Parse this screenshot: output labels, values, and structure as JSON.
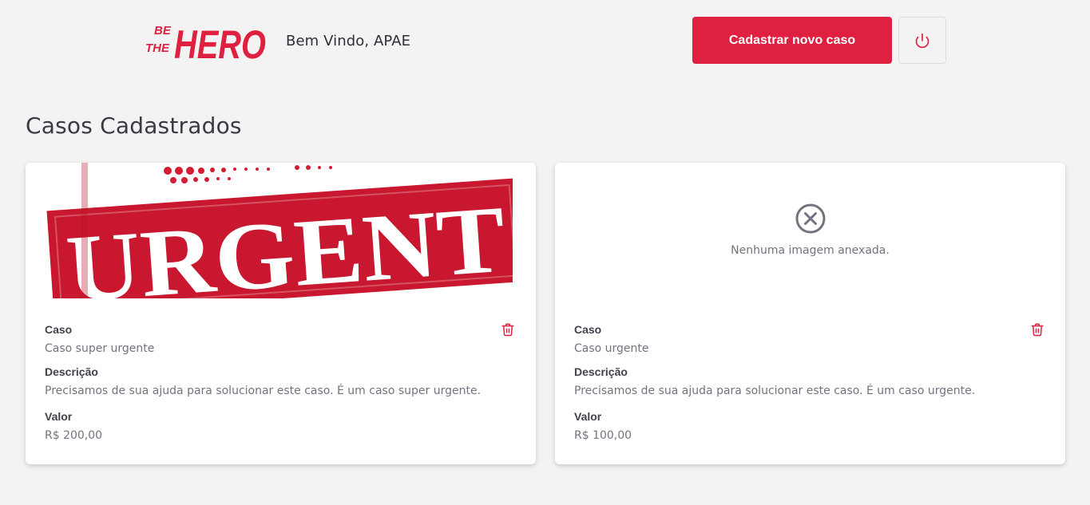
{
  "header": {
    "logo": {
      "line1": "BE",
      "line2": "THE",
      "word": "HERO"
    },
    "welcome": "Bem Vindo, APAE",
    "new_case_label": "Cadastrar novo caso",
    "logout_icon": "power-icon"
  },
  "main": {
    "title": "Casos Cadastrados"
  },
  "cases": [
    {
      "image_text": "URGENT",
      "case_label": "Caso",
      "case_value": "Caso super urgente",
      "desc_label": "Descrição",
      "desc_value": "Precisamos de sua ajuda para solucionar este caso. É um caso super urgente.",
      "value_label": "Valor",
      "value": "R$ 200,00"
    },
    {
      "no_image_text": "Nenhuma imagem anexada.",
      "case_label": "Caso",
      "case_value": "Caso urgente",
      "desc_label": "Descrição",
      "desc_value": "Precisamos de sua ajuda para solucionar este caso. É um caso urgente.",
      "value_label": "Valor",
      "value": "R$ 100,00"
    }
  ],
  "colors": {
    "accent": "#e02041",
    "background": "#f3f3f3",
    "text": "#41414d",
    "muted": "#737380"
  }
}
